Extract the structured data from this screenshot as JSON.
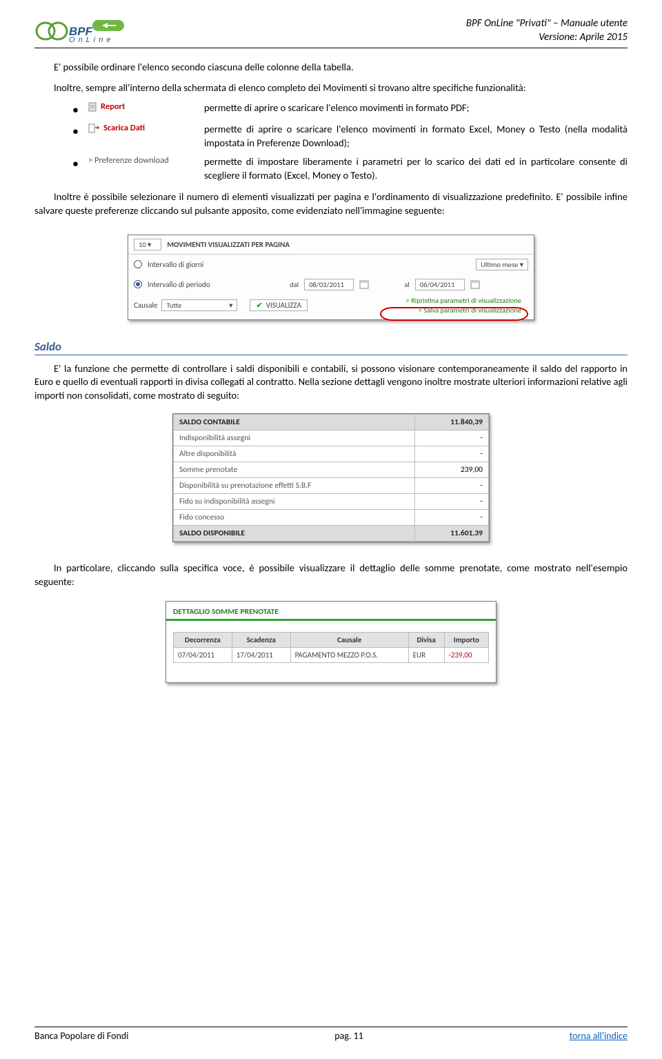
{
  "header": {
    "doc_title": "BPF OnLine \"Privati\" – Manuale utente",
    "doc_version": "Versione: Aprile 2015"
  },
  "para1": "E' possibile ordinare l'elenco secondo ciascuna delle colonne della tabella.",
  "para2": "Inoltre, sempre all'interno della schermata di elenco completo dei Movimenti si trovano altre specifiche funzionalità:",
  "bullets": [
    {
      "icon_label": "Report",
      "desc": "permette di aprire o scaricare l'elenco movimenti in formato PDF;"
    },
    {
      "icon_label": "Scarica Dati",
      "desc": "permette di aprire o scaricare l'elenco movimenti in formato Excel, Money o Testo (nella modalità impostata in Preferenze Download);"
    },
    {
      "icon_label": "> Preferenze download",
      "desc": "permette di impostare liberamente i parametri per lo scarico dei dati ed in particolare consente di scegliere il formato (Excel, Money o Testo)."
    }
  ],
  "para3": "Inoltre è possibile selezionare il numero di elementi visualizzati per pagina e l'ordinamento di visualizzazione predefinito. E' possibile infine salvare queste preferenze cliccando sul pulsante apposito, come evidenziato nell'immagine seguente:",
  "shot1": {
    "per_page": "10",
    "per_page_label": "MOVIMENTI VISUALIZZATI PER PAGINA",
    "opt_giorni": "Intervallo di giorni",
    "opt_periodo": "Intervallo di periodo",
    "ultimo_mese": "Ultimo mese",
    "dal": "dal",
    "al": "al",
    "date_from": "08/03/2011",
    "date_to": "06/04/2011",
    "causale_lbl": "Causale",
    "causale_val": "Tutte",
    "visualizza": "VISUALIZZA",
    "link1": "> Ripristina parametri di visualizzazione",
    "link2": "> Salva parametri di visualizzazione"
  },
  "section_saldo": "Saldo",
  "para_saldo": "E' la funzione che permette di controllare i saldi disponibili e contabili, si possono visionare contemporaneamente il saldo del rapporto in Euro e quello di eventuali rapporti in divisa collegati al contratto. Nella sezione dettagli vengono inoltre mostrate ulteriori informazioni relative agli importi non consolidati, come mostrato di seguito:",
  "shot2": {
    "rows": [
      {
        "k": "SALDO CONTABILE",
        "v": "11.840,39",
        "hl": true
      },
      {
        "k": "Indisponibilità assegni",
        "v": "-"
      },
      {
        "k": "Altre disponibilità",
        "v": "-"
      },
      {
        "k": "Somme prenotate",
        "v": "239,00"
      },
      {
        "k": "Disponibilità su prenotazione effetti S.B.F",
        "v": "-"
      },
      {
        "k": "Fido su indisponibilità assegni",
        "v": "-"
      },
      {
        "k": "Fido concesso",
        "v": "-"
      },
      {
        "k": "SALDO DISPONIBILE",
        "v": "11.601,39",
        "hl": true
      }
    ]
  },
  "para_dettaglio": "In particolare, cliccando sulla specifica voce, è possibile visualizzare il dettaglio delle somme prenotate, come mostrato nell'esempio seguente:",
  "shot3": {
    "title": "DETTAGLIO SOMME PRENOTATE",
    "cols": [
      "Decorrenza",
      "Scadenza",
      "Causale",
      "Divisa",
      "Importo"
    ],
    "row": {
      "dec": "07/04/2011",
      "sca": "17/04/2011",
      "cau": "PAGAMENTO MEZZO P.O.S.",
      "div": "EUR",
      "imp": "-239,00"
    }
  },
  "footer": {
    "left": "Banca Popolare di Fondi",
    "center": "pag. 11",
    "right": "torna all'indice"
  }
}
